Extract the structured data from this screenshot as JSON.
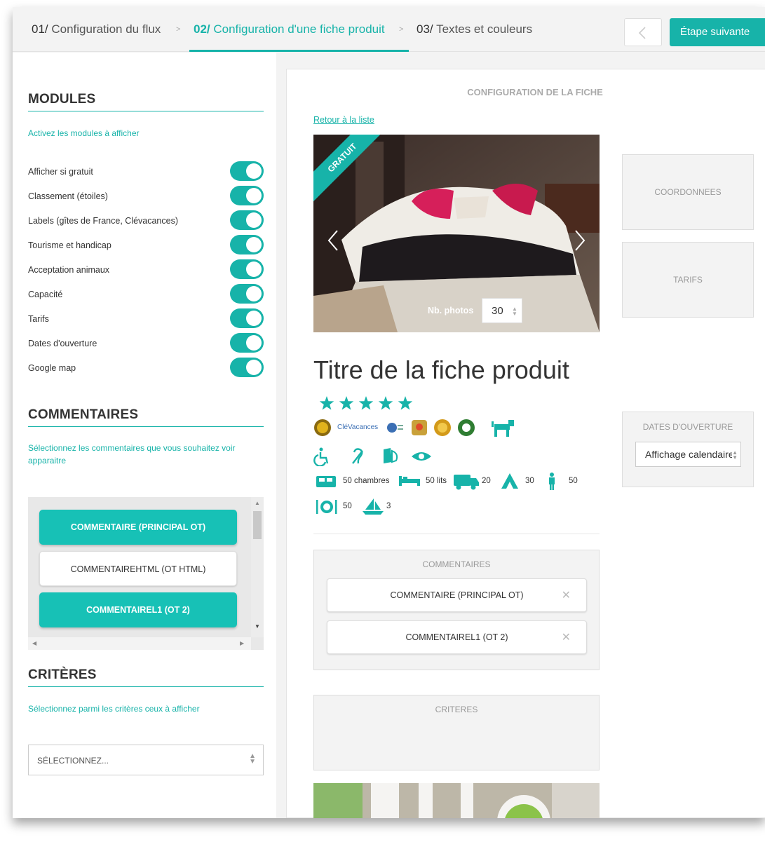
{
  "steps": [
    {
      "num": "01/",
      "label": "Configuration du flux"
    },
    {
      "num": "02/",
      "label": "Configuration d'une fiche produit"
    },
    {
      "num": "03/",
      "label": "Textes et couleurs"
    }
  ],
  "step_separator": ">",
  "active_step": 2,
  "next_button": "Étape suivante",
  "modules": {
    "title": "MODULES",
    "desc": "Activez les modules à afficher",
    "toggles": [
      {
        "label": "Afficher si gratuit",
        "on": true
      },
      {
        "label": "Classement (étoiles)",
        "on": true
      },
      {
        "label": "Labels (gîtes de France, Clévacances)",
        "on": true
      },
      {
        "label": "Tourisme et handicap",
        "on": true
      },
      {
        "label": "Acceptation animaux",
        "on": true
      },
      {
        "label": "Capacité",
        "on": true
      },
      {
        "label": "Tarifs",
        "on": true
      },
      {
        "label": "Dates d'ouverture",
        "on": true
      },
      {
        "label": "Google map",
        "on": true
      }
    ]
  },
  "commentaires": {
    "title": "COMMENTAIRES",
    "desc": "Sélectionnez les commentaires que vous souhaitez voir apparaitre",
    "items": [
      {
        "label": "COMMENTAIRE (PRINCIPAL OT)",
        "selected": true
      },
      {
        "label": "COMMENTAIREHTML (OT HTML)",
        "selected": false
      },
      {
        "label": "COMMENTAIREL1 (OT 2)",
        "selected": true
      }
    ]
  },
  "criteres": {
    "title": "CRITÈRES",
    "desc": "Sélectionnez parmi les critères ceux à afficher",
    "placeholder": "SÉLECTIONNEZ..."
  },
  "preview": {
    "title": "CONFIGURATION DE LA FICHE",
    "back_link": "Retour à la liste",
    "ribbon": "GRATUIT",
    "nb_photos_label": "Nb. photos",
    "nb_photos_value": "30",
    "product_title": "Titre de la fiche produit",
    "stars": 5,
    "clevacances_text": "CléVacances",
    "capacity": [
      {
        "icon": "room-icon",
        "text": "50 chambres"
      },
      {
        "icon": "bed-icon",
        "text": "50 lits"
      },
      {
        "icon": "camper-icon",
        "text": "20"
      },
      {
        "icon": "tent-icon",
        "text": "30"
      },
      {
        "icon": "person-icon",
        "text": "50"
      },
      {
        "icon": "dining-icon",
        "text": "50"
      },
      {
        "icon": "boat-icon",
        "text": "3"
      }
    ],
    "comments_box": {
      "title": "COMMENTAIRES",
      "chips": [
        "COMMENTAIRE (PRINCIPAL OT)",
        "COMMENTAIREL1 (OT 2)"
      ],
      "remove_glyph": "✕"
    },
    "criteres_box_title": "CRITERES",
    "side": {
      "coordonnees": "COORDONNEES",
      "tarifs": "TARIFS",
      "dates_title": "DATES D'OUVERTURE",
      "calendar_select": "Affichage calendaire"
    }
  },
  "colors": {
    "accent": "#17b3a9",
    "accent_button": "#17c1b6"
  }
}
